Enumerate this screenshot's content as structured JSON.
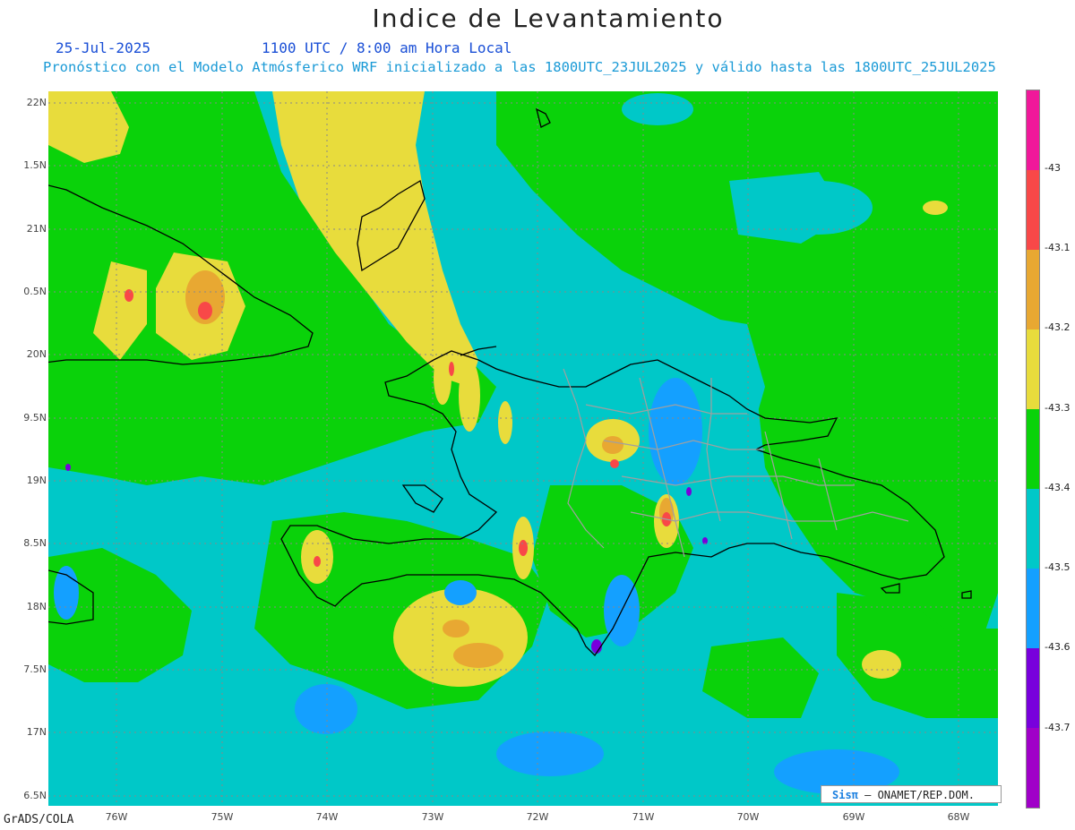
{
  "header": {
    "title": "Indice de Levantamiento",
    "date": "25-Jul-2025",
    "time": "1100 UTC / 8:00 am Hora Local",
    "subtitle": "Pronóstico con el Modelo Atmósferico WRF inicializado a las 1800UTC_23JUL2025 y válido hasta las  1800UTC_25JUL2025"
  },
  "axes": {
    "lat_labels": [
      "22N",
      "1.5N",
      "21N",
      "0.5N",
      "20N",
      "9.5N",
      "19N",
      "8.5N",
      "18N",
      "7.5N",
      "17N",
      "6.5N"
    ],
    "lon_labels": [
      "76W",
      "75W",
      "74W",
      "73W",
      "72W",
      "71W",
      "70W",
      "69W",
      "68W"
    ]
  },
  "colorbar": {
    "labels": [
      "-43",
      "-43.1",
      "-43.2",
      "-43.3",
      "-43.4",
      "-43.5",
      "-43.6",
      "-43.7"
    ],
    "colors": [
      "#f0189a",
      "#f84848",
      "#e8a832",
      "#e8dc3c",
      "#0ad20a",
      "#00c8c8",
      "#14a0ff",
      "#7800dc",
      "#a000c8"
    ]
  },
  "footer": {
    "software": "GrADS/COLA",
    "logo": "Sisπ",
    "credit": " – ONAMET/REP.DOM."
  }
}
